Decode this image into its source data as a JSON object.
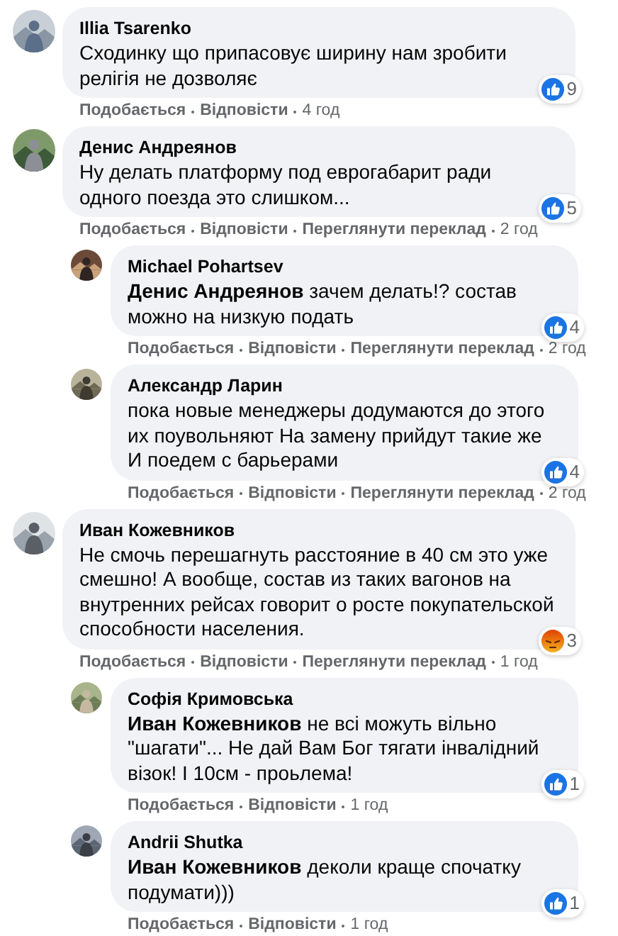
{
  "comments": [
    {
      "author": "Illia Tsarenko",
      "text": "Сходинку що припасовує ширину нам зробити релігія не дозволяє",
      "reaction": {
        "kind": "like",
        "count": "9"
      },
      "actions": [
        "Подобається",
        "Відповісти"
      ],
      "time": "4 год"
    },
    {
      "author": "Денис Андреянов",
      "text": "Ну делать платформу под еврогабарит ради одного поезда это слишком...",
      "reaction": {
        "kind": "like",
        "count": "5"
      },
      "actions": [
        "Подобається",
        "Відповісти",
        "Переглянути переклад"
      ],
      "time": "2 год",
      "replies": [
        {
          "author": "Michael Pohartsev",
          "text": "**Денис Андреянов** зачем делать!? состав можно на низкую подать",
          "reaction": {
            "kind": "like",
            "count": "4"
          },
          "actions": [
            "Подобається",
            "Відповісти",
            "Переглянути переклад"
          ],
          "time": "2 год"
        },
        {
          "author": "Александр Ларин",
          "text": "пока новые менеджеры додумаются до этого их поувольняют На замену прийдут такие же И поедем с барьерами",
          "reaction": {
            "kind": "like",
            "count": "4"
          },
          "actions": [
            "Подобається",
            "Відповісти",
            "Переглянути переклад"
          ],
          "time": "2 год"
        }
      ]
    },
    {
      "author": "Иван Кожевников",
      "text": "Не смочь перешагнуть расстояние в 40 см это уже смешно! А вообще, состав из таких вагонов на внутренних рейсах говорит о росте покупательской способности населения.",
      "reaction": {
        "kind": "angry",
        "count": "3"
      },
      "actions": [
        "Подобається",
        "Відповісти",
        "Переглянути переклад"
      ],
      "time": "1 год",
      "replies": [
        {
          "author": "Софія Кримовська",
          "text": "**Иван Кожевников** не всі можуть вільно \"шагати\"... Не дай Вам Бог тягати інвалідний візок! І 10см - проьлема!",
          "reaction": {
            "kind": "like",
            "count": "1"
          },
          "actions": [
            "Подобається",
            "Відповісти"
          ],
          "time": "1 год"
        },
        {
          "author": "Andrii Shutka",
          "text": "**Иван Кожевников** деколи краще спочатку подумати)))",
          "reaction": {
            "kind": "like",
            "count": "1"
          },
          "actions": [
            "Подобається",
            "Відповісти"
          ],
          "time": "1 год"
        }
      ]
    }
  ]
}
